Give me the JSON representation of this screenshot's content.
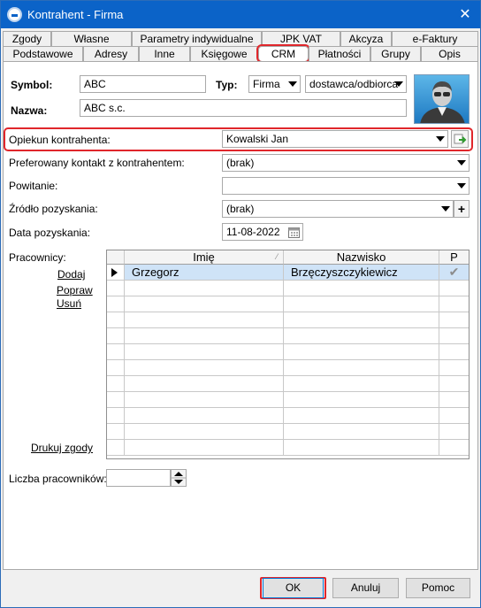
{
  "window": {
    "title": "Kontrahent - Firma",
    "close_glyph": "✕"
  },
  "tabs_top": [
    "Zgody",
    "Własne",
    "Parametry indywidualne",
    "JPK VAT",
    "Akcyza",
    "e-Faktury"
  ],
  "tabs_bottom": [
    "Podstawowe",
    "Adresy",
    "Inne",
    "Księgowe",
    "CRM",
    "Płatności",
    "Grupy",
    "Opis"
  ],
  "active_tab": "CRM",
  "header": {
    "symbol_label": "Symbol:",
    "symbol_value": "ABC",
    "typ_label": "Typ:",
    "typ_value": "Firma",
    "typ2_value": "dostawca/odbiorca",
    "nazwa_label": "Nazwa:",
    "nazwa_value": "ABC s.c."
  },
  "crm": {
    "opiekun_label": "Opiekun kontrahenta:",
    "opiekun_value": "Kowalski Jan",
    "kontakt_label": "Preferowany kontakt z kontrahentem:",
    "kontakt_value": "(brak)",
    "powitanie_label": "Powitanie:",
    "powitanie_value": "",
    "zrodlo_label": "Źródło pozyskania:",
    "zrodlo_value": "(brak)",
    "data_label": "Data pozyskania:",
    "data_value": "11-08-2022",
    "pracownicy_label": "Pracownicy:",
    "links": {
      "dodaj": "Dodaj",
      "popraw": "Popraw",
      "usun": "Usuń",
      "drukuj": "Drukuj zgody"
    },
    "grid": {
      "columns": [
        "Imię",
        "Nazwisko",
        "P"
      ],
      "rows": [
        {
          "imie": "Grzegorz",
          "nazwisko": "Brzęczyszczykiewicz",
          "p": "✔"
        }
      ],
      "empty_rows": 11
    },
    "liczba_label": "Liczba pracowników:",
    "liczba_value": ""
  },
  "buttons": {
    "ok": "OK",
    "anuluj": "Anuluj",
    "pomoc": "Pomoc"
  },
  "colors": {
    "title_bar": "#0b63c8",
    "highlight": "#e0262b",
    "selection": "#cfe3f7"
  }
}
